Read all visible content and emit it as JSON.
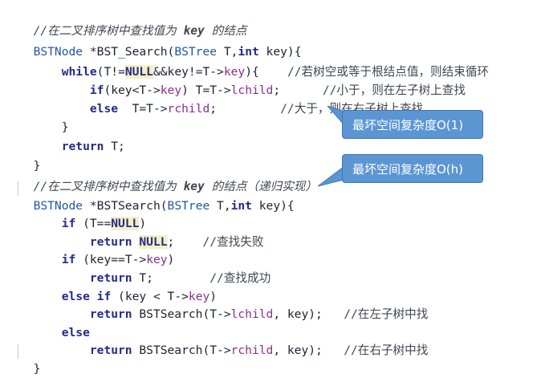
{
  "code": {
    "iterative": {
      "comment_head": "//在二叉排序树中查找值为 ",
      "comment_key": "key",
      "comment_tail": " 的结点",
      "sig_type": "BSTNode",
      "sig_name": " *BST_Search(",
      "sig_param_type": "BSTree",
      "sig_param_name": " T,",
      "sig_int": "int",
      "sig_key": " key){",
      "while_indent": "    ",
      "while_kw": "while",
      "while_open": "(T!=",
      "while_null": "NULL",
      "while_cond_a": "&&key!=T->",
      "while_member": "key",
      "while_close": "){",
      "while_comment_pad": "    ",
      "while_comment": "//若树空或等于根结点值，则结束循环",
      "if_indent": "        ",
      "if_kw": "if",
      "if_cond": "(key<T->",
      "if_member": "key",
      "if_mid": ") T=T->",
      "if_member2": "lchild",
      "if_end": ";",
      "if_comment_pad": "      ",
      "if_comment": "//小于，则在左子树上查找",
      "else_indent": "        ",
      "else_kw": "else",
      "else_body": "  T=T->",
      "else_member": "rchild",
      "else_end": ";",
      "else_comment_pad": "         ",
      "else_comment": "//大于，则在右子树上查找",
      "close_brace_inner": "    }",
      "return_indent": "    ",
      "return_kw": "return",
      "return_val": " T;",
      "close_brace": "}"
    },
    "recursive": {
      "comment_head": "//在二叉排序树中查找值为 ",
      "comment_key": "key",
      "comment_tail": " 的结点（递归实现）",
      "sig_type": "BSTNode",
      "sig_name": " *BSTSearch(",
      "sig_param_type": "BSTree",
      "sig_param_name": " T,",
      "sig_int": "int",
      "sig_key": " key){",
      "if1_indent": "    ",
      "if1_kw": "if",
      "if1_open": " (T==",
      "if1_null": "NULL",
      "if1_close": ")",
      "ret1_indent": "        ",
      "ret1_kw": "return",
      "ret1_space": " ",
      "ret1_null": "NULL",
      "ret1_end": ";",
      "ret1_comment_pad": "    ",
      "ret1_comment": "//查找失败",
      "if2_indent": "    ",
      "if2_kw": "if",
      "if2_open": " (key==T->",
      "if2_member": "key",
      "if2_close": ")",
      "ret2_indent": "        ",
      "ret2_kw": "return",
      "ret2_val": " T;",
      "ret2_comment_pad": "        ",
      "ret2_comment": "//查找成功",
      "elseif_indent": "    ",
      "elseif_kw": "else if",
      "elseif_open": " (key < T->",
      "elseif_member": "key",
      "elseif_close": ")",
      "ret3_indent": "        ",
      "ret3_kw": "return",
      "ret3_call": " BSTSearch(T->",
      "ret3_member": "lchild",
      "ret3_end": ", key);",
      "ret3_comment_pad": "   ",
      "ret3_comment": "//在左子树中找",
      "else_indent": "    ",
      "else_kw": "else",
      "ret4_indent": "        ",
      "ret4_kw": "return",
      "ret4_call": " BSTSearch(T->",
      "ret4_member": "rchild",
      "ret4_end": ", key);",
      "ret4_comment_pad": "   ",
      "ret4_comment": "//在右子树中找",
      "close_brace": "}"
    }
  },
  "callouts": {
    "space_iterative": "最坏空间复杂度O(1)",
    "space_recursive": "最坏空间复杂度O(h)"
  },
  "colors": {
    "keyword": "#262a8c",
    "type": "#1f57a5",
    "member": "#8a2f8f",
    "comment": "#3f4750",
    "null_highlight": "#f4f0c3",
    "callout_fill": "#5b96d2"
  }
}
